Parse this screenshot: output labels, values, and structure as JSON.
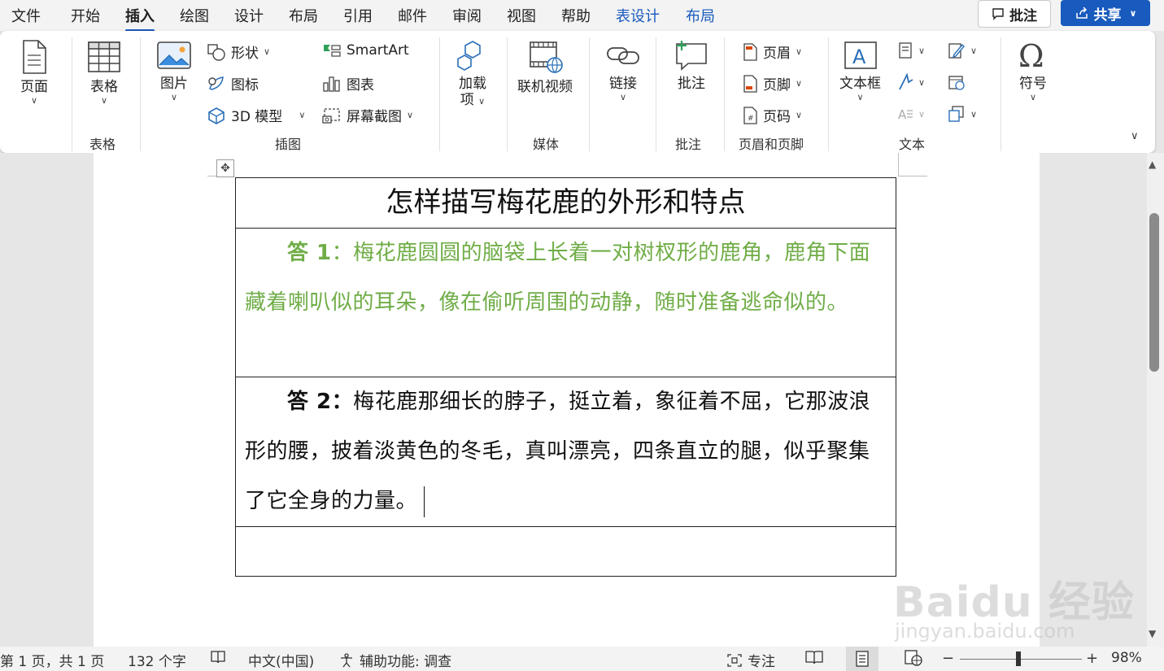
{
  "tabs": [
    "文件",
    "开始",
    "插入",
    "绘图",
    "设计",
    "布局",
    "引用",
    "邮件",
    "审阅",
    "视图",
    "帮助",
    "表设计",
    "布局"
  ],
  "active_tab": "插入",
  "top_right": {
    "comments": "批注",
    "share": "共享"
  },
  "ribbon": {
    "groups": {
      "pages": {
        "button": "页面"
      },
      "tables": {
        "button": "表格",
        "label": "表格"
      },
      "illustrations": {
        "label": "插图",
        "picture": "图片",
        "shapes": "形状",
        "icons": "图标",
        "model3d": "3D 模型",
        "smartart": "SmartArt",
        "chart": "图表",
        "screenshot": "屏幕截图"
      },
      "addins": {
        "button_line1": "加载",
        "button_line2": "项"
      },
      "media": {
        "button": "联机视频",
        "label": "媒体"
      },
      "links": {
        "button": "链接"
      },
      "comments": {
        "button": "批注",
        "label": "批注"
      },
      "header_footer": {
        "header": "页眉",
        "footer": "页脚",
        "page_number": "页码",
        "label": "页眉和页脚"
      },
      "text": {
        "textbox": "文本框",
        "label": "文本"
      },
      "symbols": {
        "button": "符号"
      }
    }
  },
  "document": {
    "table": {
      "title": "怎样描写梅花鹿的外形和特点",
      "answer1_lead": "答 1",
      "answer1_body": "：梅花鹿圆圆的脑袋上长着一对树杈形的鹿角，鹿角下面藏着喇叭似的耳朵，像在偷听周围的动静，随时准备逃命似的。",
      "answer2_lead": "答 2：",
      "answer2_body": "梅花鹿那细长的脖子，挺立着，象征着不屈，它那波浪形的腰，披着淡黄色的冬毛，真叫漂亮，四条直立的腿，似乎聚集了它全身的力量。"
    },
    "answer1_color": "#70ad47"
  },
  "watermark": {
    "main": "Baidu 经验",
    "sub": "jingyan.baidu.com"
  },
  "status": {
    "page": "第 1 页，共 1 页",
    "words": "132 个字",
    "language": "中文(中国)",
    "accessibility": "辅助功能: 调查",
    "focus": "专注",
    "zoom": "98%"
  },
  "colors": {
    "accent": "#185abd",
    "green": "#70ad47"
  }
}
